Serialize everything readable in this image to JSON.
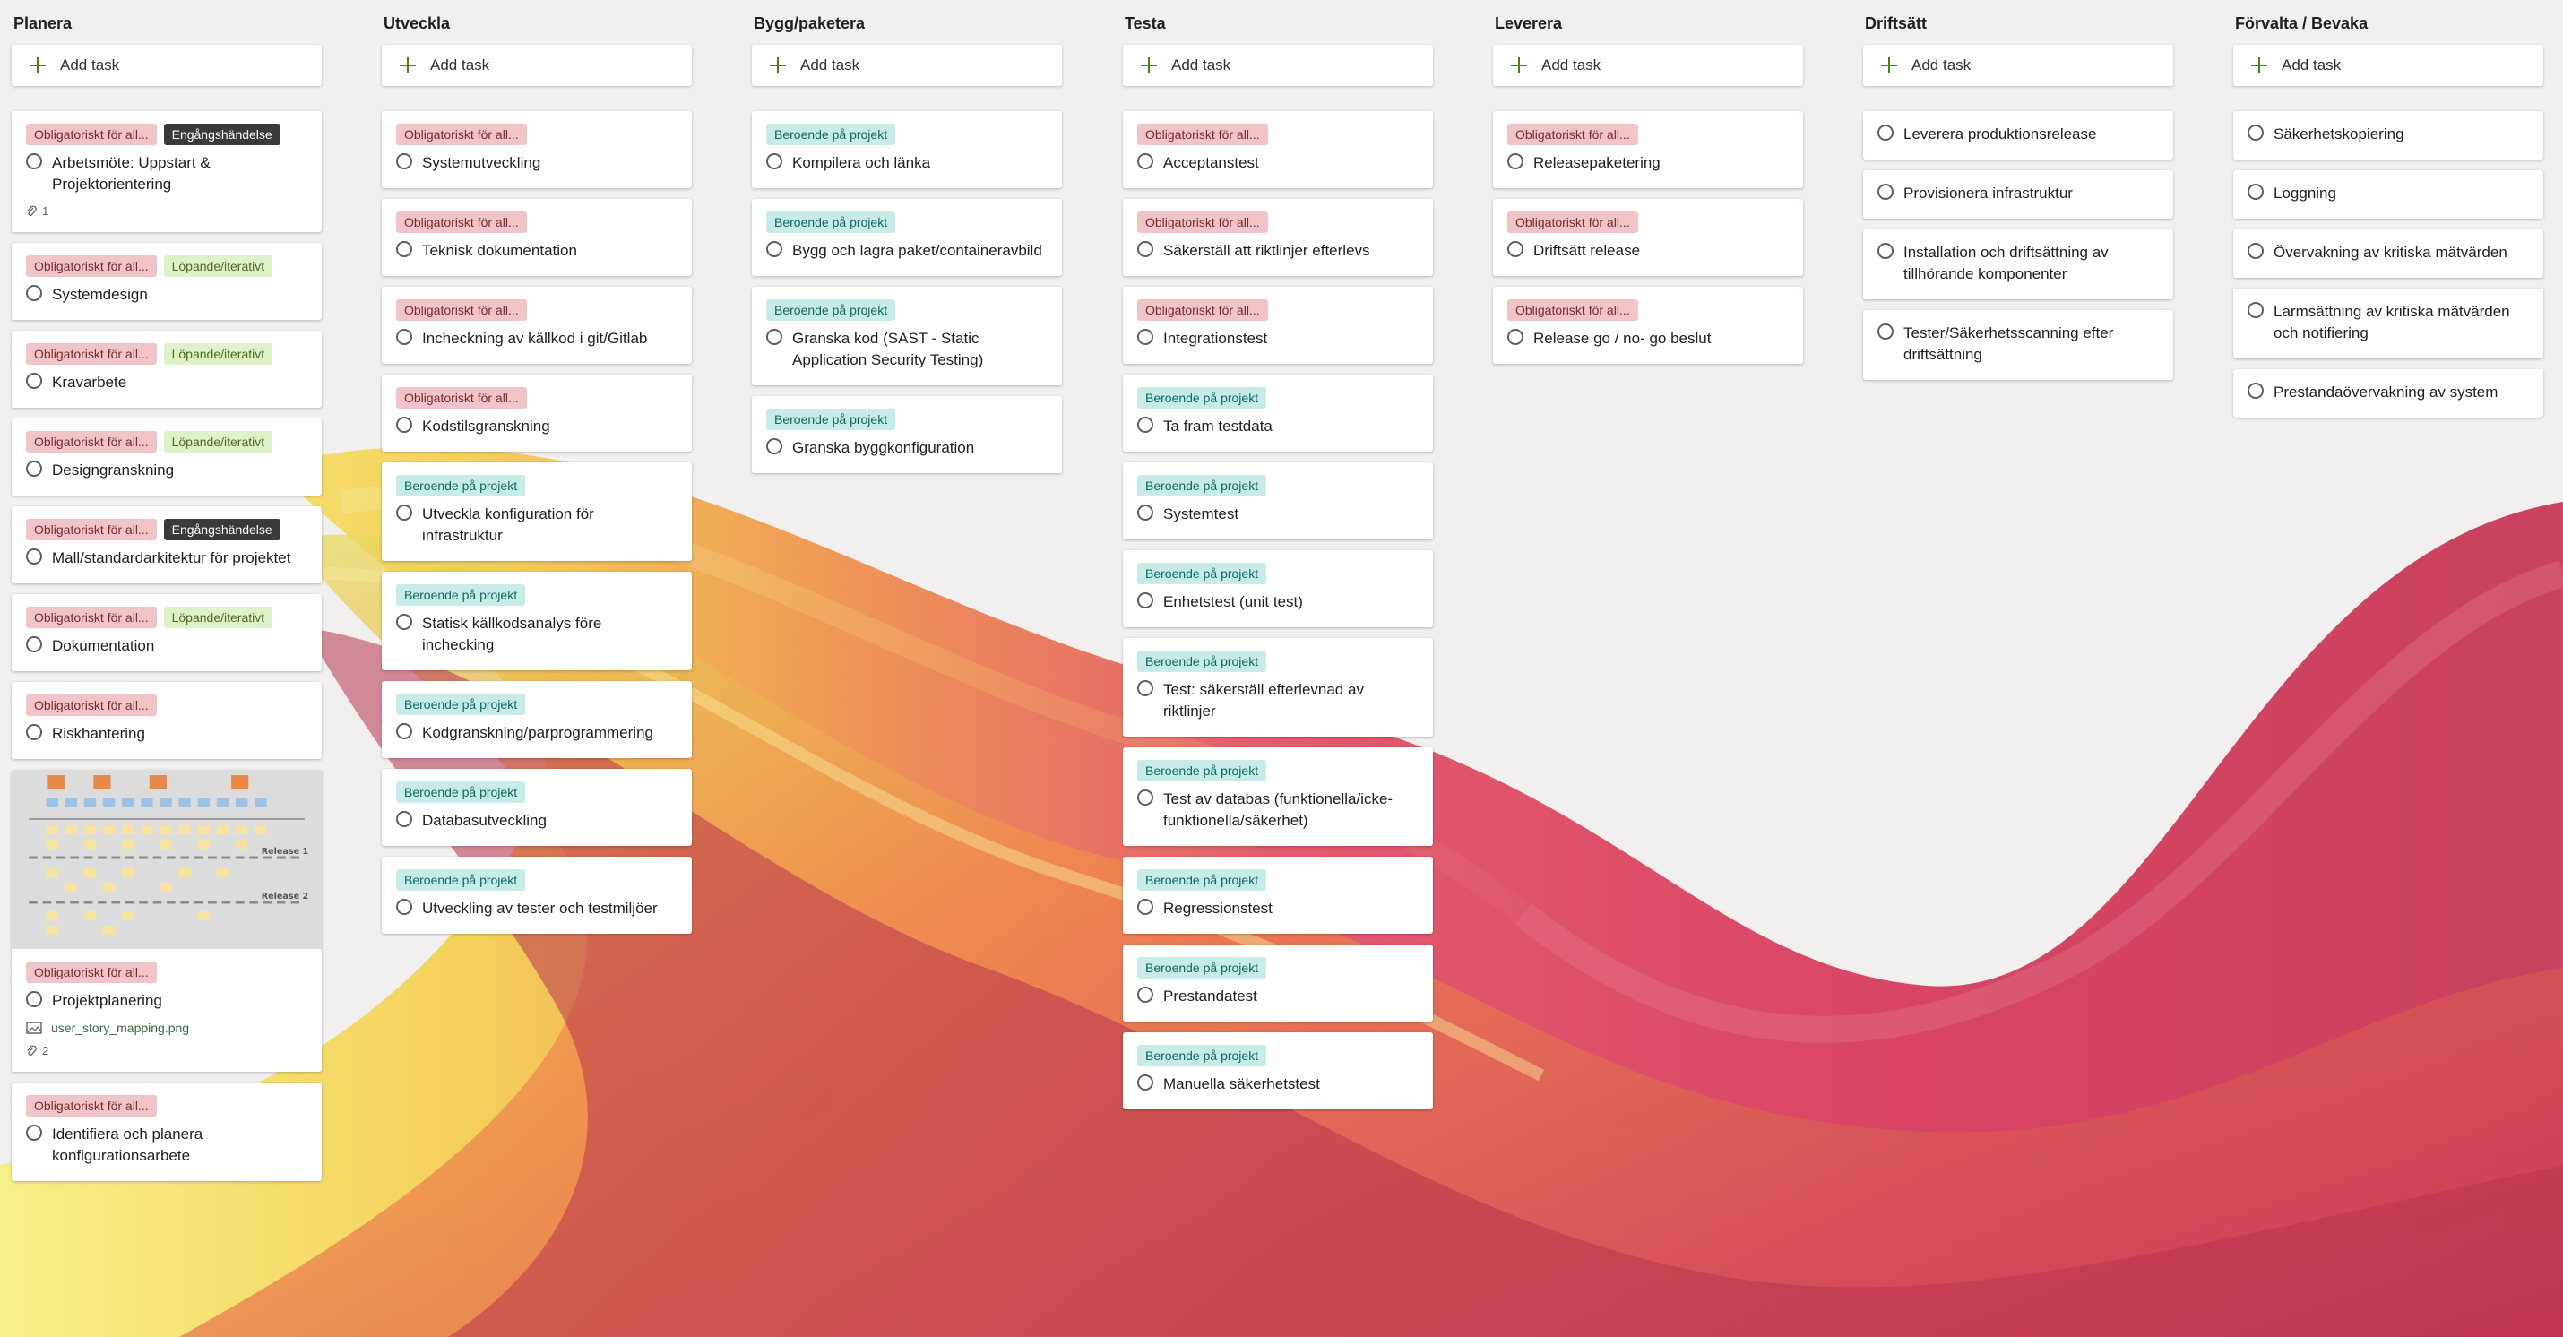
{
  "add_task_label": "Add task",
  "colors": {
    "obligatoriskt_bg": "#f1c4c8",
    "engangshandelse_bg": "#3b3a39",
    "lopande_bg": "#dff1c8",
    "beroende_bg": "#c7ebe7",
    "add_icon": "#498205"
  },
  "columns": [
    {
      "title": "Planera",
      "tasks": [
        {
          "labels": [
            {
              "text": "Obligatoriskt för all...",
              "kind": "obl"
            },
            {
              "text": "Engångshändelse",
              "kind": "eng"
            }
          ],
          "title": "Arbetsmöte: Uppstart & Projektorientering",
          "attachments": "1"
        },
        {
          "labels": [
            {
              "text": "Obligatoriskt för all...",
              "kind": "obl"
            },
            {
              "text": "Löpande/iterativt",
              "kind": "lop"
            }
          ],
          "title": "Systemdesign"
        },
        {
          "labels": [
            {
              "text": "Obligatoriskt för all...",
              "kind": "obl"
            },
            {
              "text": "Löpande/iterativt",
              "kind": "lop"
            }
          ],
          "title": "Kravarbete"
        },
        {
          "labels": [
            {
              "text": "Obligatoriskt för all...",
              "kind": "obl"
            },
            {
              "text": "Löpande/iterativt",
              "kind": "lop"
            }
          ],
          "title": "Designgranskning"
        },
        {
          "labels": [
            {
              "text": "Obligatoriskt för all...",
              "kind": "obl"
            },
            {
              "text": "Engångshändelse",
              "kind": "eng"
            }
          ],
          "title": "Mall/standardarkitektur för projektet"
        },
        {
          "labels": [
            {
              "text": "Obligatoriskt för all...",
              "kind": "obl"
            },
            {
              "text": "Löpande/iterativt",
              "kind": "lop"
            }
          ],
          "title": "Dokumentation"
        },
        {
          "labels": [
            {
              "text": "Obligatoriskt för all...",
              "kind": "obl"
            }
          ],
          "title": "Riskhantering"
        },
        {
          "thumbnail": true,
          "thumb_texts": [
            "Release 1",
            "Release 2"
          ],
          "labels": [
            {
              "text": "Obligatoriskt för all...",
              "kind": "obl"
            }
          ],
          "title": "Projektplanering",
          "attachment_file": "user_story_mapping.png",
          "attachments": "2"
        },
        {
          "labels": [
            {
              "text": "Obligatoriskt för all...",
              "kind": "obl"
            }
          ],
          "title": "Identifiera och planera konfigurationsarbete"
        }
      ]
    },
    {
      "title": "Utveckla",
      "tasks": [
        {
          "labels": [
            {
              "text": "Obligatoriskt för all...",
              "kind": "obl"
            }
          ],
          "title": "Systemutveckling"
        },
        {
          "labels": [
            {
              "text": "Obligatoriskt för all...",
              "kind": "obl"
            }
          ],
          "title": "Teknisk dokumentation"
        },
        {
          "labels": [
            {
              "text": "Obligatoriskt för all...",
              "kind": "obl"
            }
          ],
          "title": "Incheckning av källkod i git/Gitlab"
        },
        {
          "labels": [
            {
              "text": "Obligatoriskt för all...",
              "kind": "obl"
            }
          ],
          "title": "Kodstilsgranskning"
        },
        {
          "labels": [
            {
              "text": "Beroende på projekt",
              "kind": "ber"
            }
          ],
          "title": "Utveckla konfiguration för infrastruktur"
        },
        {
          "labels": [
            {
              "text": "Beroende på projekt",
              "kind": "ber"
            }
          ],
          "title": "Statisk källkodsanalys före inchecking"
        },
        {
          "labels": [
            {
              "text": "Beroende på projekt",
              "kind": "ber"
            }
          ],
          "title": "Kodgranskning/parprogrammering"
        },
        {
          "labels": [
            {
              "text": "Beroende på projekt",
              "kind": "ber"
            }
          ],
          "title": "Databasutveckling"
        },
        {
          "labels": [
            {
              "text": "Beroende på projekt",
              "kind": "ber"
            }
          ],
          "title": "Utveckling av tester och testmiljöer"
        }
      ]
    },
    {
      "title": "Bygg/paketera",
      "tasks": [
        {
          "labels": [
            {
              "text": "Beroende på projekt",
              "kind": "ber"
            }
          ],
          "title": "Kompilera och länka"
        },
        {
          "labels": [
            {
              "text": "Beroende på projekt",
              "kind": "ber"
            }
          ],
          "title": "Bygg och lagra paket/containeravbild"
        },
        {
          "labels": [
            {
              "text": "Beroende på projekt",
              "kind": "ber"
            }
          ],
          "title": "Granska kod (SAST - Static Application Security Testing)"
        },
        {
          "labels": [
            {
              "text": "Beroende på projekt",
              "kind": "ber"
            }
          ],
          "title": "Granska byggkonfiguration"
        }
      ]
    },
    {
      "title": "Testa",
      "tasks": [
        {
          "labels": [
            {
              "text": "Obligatoriskt för all...",
              "kind": "obl"
            }
          ],
          "title": "Acceptanstest"
        },
        {
          "labels": [
            {
              "text": "Obligatoriskt för all...",
              "kind": "obl"
            }
          ],
          "title": "Säkerställ att riktlinjer efterlevs"
        },
        {
          "labels": [
            {
              "text": "Obligatoriskt för all...",
              "kind": "obl"
            }
          ],
          "title": "Integrationstest"
        },
        {
          "labels": [
            {
              "text": "Beroende på projekt",
              "kind": "ber"
            }
          ],
          "title": "Ta fram testdata"
        },
        {
          "labels": [
            {
              "text": "Beroende på projekt",
              "kind": "ber"
            }
          ],
          "title": "Systemtest"
        },
        {
          "labels": [
            {
              "text": "Beroende på projekt",
              "kind": "ber"
            }
          ],
          "title": "Enhetstest (unit test)"
        },
        {
          "labels": [
            {
              "text": "Beroende på projekt",
              "kind": "ber"
            }
          ],
          "title": "Test: säkerställ efterlevnad av riktlinjer"
        },
        {
          "labels": [
            {
              "text": "Beroende på projekt",
              "kind": "ber"
            }
          ],
          "title": "Test av databas (funktionella/icke-funktionella/säkerhet)"
        },
        {
          "labels": [
            {
              "text": "Beroende på projekt",
              "kind": "ber"
            }
          ],
          "title": "Regressionstest"
        },
        {
          "labels": [
            {
              "text": "Beroende på projekt",
              "kind": "ber"
            }
          ],
          "title": "Prestandatest"
        },
        {
          "labels": [
            {
              "text": "Beroende på projekt",
              "kind": "ber"
            }
          ],
          "title": "Manuella säkerhetstest"
        }
      ]
    },
    {
      "title": "Leverera",
      "tasks": [
        {
          "labels": [
            {
              "text": "Obligatoriskt för all...",
              "kind": "obl"
            }
          ],
          "title": "Releasepaketering"
        },
        {
          "labels": [
            {
              "text": "Obligatoriskt för all...",
              "kind": "obl"
            }
          ],
          "title": "Driftsätt release"
        },
        {
          "labels": [
            {
              "text": "Obligatoriskt för all...",
              "kind": "obl"
            }
          ],
          "title": "Release go / no- go beslut"
        }
      ]
    },
    {
      "title": "Driftsätt",
      "tasks": [
        {
          "labels": [],
          "title": "Leverera produktionsrelease"
        },
        {
          "labels": [],
          "title": "Provisionera infrastruktur"
        },
        {
          "labels": [],
          "title": "Installation och driftsättning av tillhörande komponenter"
        },
        {
          "labels": [],
          "title": "Tester/Säkerhetsscanning efter driftsättning"
        }
      ]
    },
    {
      "title": "Förvalta / Bevaka",
      "tasks": [
        {
          "labels": [],
          "title": "Säkerhetskopiering"
        },
        {
          "labels": [],
          "title": "Loggning"
        },
        {
          "labels": [],
          "title": "Övervakning av kritiska mätvärden"
        },
        {
          "labels": [],
          "title": "Larmsättning av kritiska mätvärden och notifiering"
        },
        {
          "labels": [],
          "title": "Prestandaövervakning av system"
        }
      ]
    }
  ]
}
